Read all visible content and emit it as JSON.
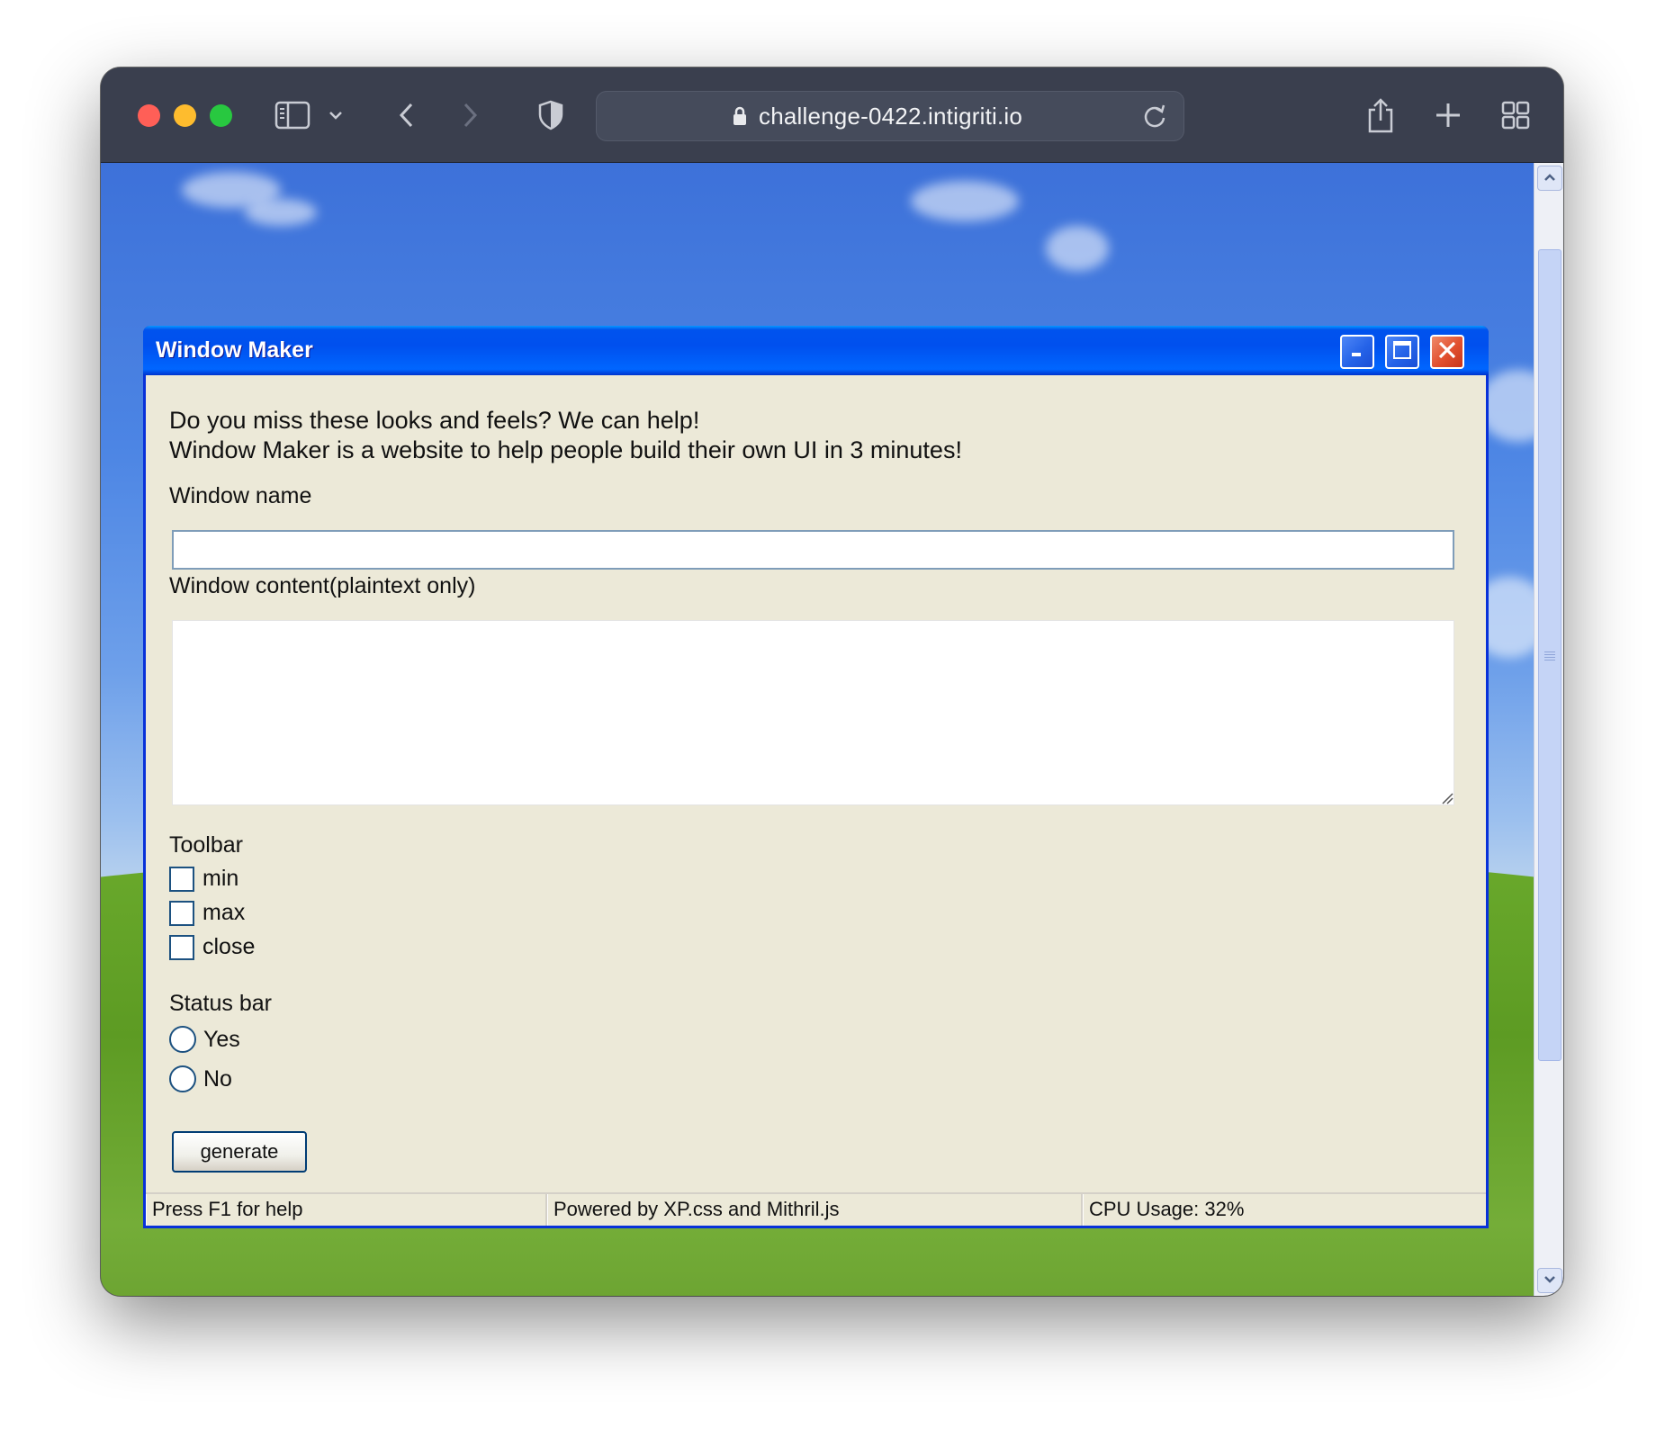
{
  "browser": {
    "url": "challenge-0422.intigriti.io",
    "icons": [
      "sidebar-icon",
      "chevron-down-icon",
      "back-arrow-icon",
      "forward-arrow-icon",
      "shield-icon",
      "lock-icon",
      "reload-icon",
      "share-icon",
      "plus-icon",
      "tab-overview-icon"
    ]
  },
  "window": {
    "title": "Window Maker",
    "intro_line1": "Do you miss these looks and feels? We can help!",
    "intro_line2": "Window Maker is a website to help people build their own UI in 3 minutes!",
    "name_label": "Window name",
    "name_value": "",
    "content_label": "Window content(plaintext only)",
    "content_value": "",
    "toolbar_label": "Toolbar",
    "toolbar_options": [
      {
        "label": "min",
        "checked": false
      },
      {
        "label": "max",
        "checked": false
      },
      {
        "label": "close",
        "checked": false
      }
    ],
    "statusbar_label": "Status bar",
    "statusbar_options": [
      {
        "label": "Yes",
        "selected": false
      },
      {
        "label": "No",
        "selected": false
      }
    ],
    "generate_label": "generate"
  },
  "statusbar": {
    "help": "Press F1 for help",
    "powered": "Powered by XP.css and Mithril.js",
    "cpu": "CPU Usage: 32%"
  },
  "colors": {
    "xp_title_blue": "#0053ee",
    "xp_close_red": "#e14f2e",
    "xp_body": "#ece9d8",
    "browser_chrome": "#3a3f4e"
  }
}
